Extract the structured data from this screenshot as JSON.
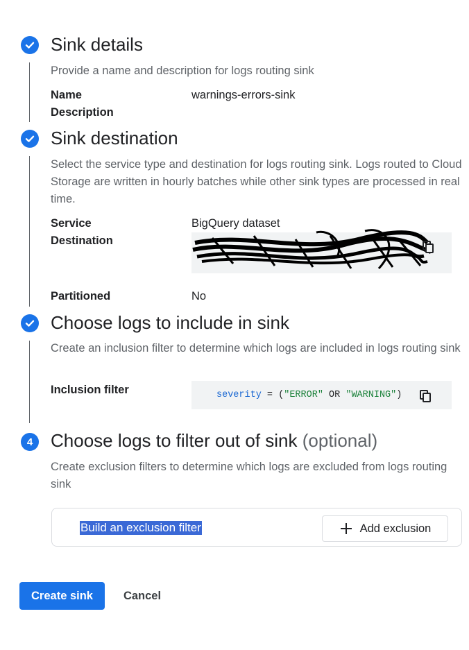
{
  "steps": [
    {
      "title": "Sink details",
      "description": "Provide a name and description for logs routing sink",
      "fields": {
        "name_label": "Name",
        "name_value": "warnings-errors-sink",
        "description_label": "Description"
      }
    },
    {
      "title": "Sink destination",
      "description": "Select the service type and destination for logs routing sink. Logs routed to Cloud Storage are written in hourly batches while other sink types are processed in real time.",
      "fields": {
        "service_label": "Service",
        "service_value": "BigQuery dataset",
        "destination_label": "Destination",
        "partitioned_label": "Partitioned",
        "partitioned_value": "No"
      }
    },
    {
      "title": "Choose logs to include in sink",
      "description": "Create an inclusion filter to determine which logs are included in logs routing sink",
      "fields": {
        "inclusion_label": "Inclusion filter",
        "filter_key": "severity",
        "filter_eq": " = (",
        "filter_val1": "\"ERROR\"",
        "filter_or": " OR ",
        "filter_val2": "\"WARNING\"",
        "filter_close": ")"
      }
    },
    {
      "number": "4",
      "title": "Choose logs to filter out of sink",
      "optional": "(optional)",
      "description": "Create exclusion filters to determine which logs are excluded from logs routing sink",
      "build_link": "Build an exclusion filter",
      "add_button": "Add exclusion"
    }
  ],
  "actions": {
    "create": "Create sink",
    "cancel": "Cancel"
  },
  "colors": {
    "accent": "#1a73e8",
    "muted": "#5f6368",
    "code_bg": "#f1f3f4"
  }
}
